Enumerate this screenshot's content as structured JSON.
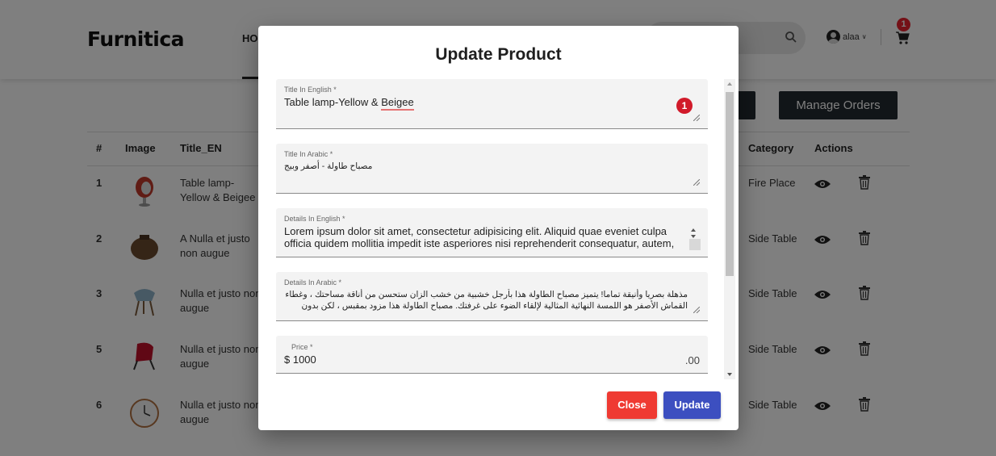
{
  "header": {
    "logo": "Furnitica",
    "nav_home": "HO",
    "user_name": "alaa",
    "cart_count": "1"
  },
  "actions": {
    "manage_orders": "Manage Orders"
  },
  "table": {
    "headers": {
      "num": "#",
      "image": "Image",
      "title": "Title_EN",
      "category": "Category",
      "actions": "Actions"
    },
    "rows": [
      {
        "num": "1",
        "title": "Table lamp-Yellow & Beigee",
        "category": "Fire Place",
        "image_icon": "egg-chair-icon"
      },
      {
        "num": "2",
        "title": "A Nulla et justo non augue",
        "category": "Side Table",
        "image_icon": "wicker-basket-icon"
      },
      {
        "num": "3",
        "title": "Nulla et justo non augue",
        "category": "Side Table",
        "image_icon": "blue-chair-icon"
      },
      {
        "num": "5",
        "title": "Nulla et justo non augue",
        "category": "Side Table",
        "image_icon": "red-chair-icon"
      },
      {
        "num": "6",
        "title": "Nulla et justo non augue",
        "category": "Side Table",
        "image_icon": "wall-clock-icon"
      }
    ]
  },
  "modal": {
    "title": "Update Product",
    "fields": {
      "title_en": {
        "label": "Title In English *",
        "value_before": "Table lamp-Yellow & ",
        "value_misspelled": "Beigee",
        "badge": "1"
      },
      "title_ar": {
        "label": "Title In Arabic *",
        "value": "مصباح طاولة - أصفر وبيج"
      },
      "details_en": {
        "label": "Details In English *",
        "value": "Lorem ipsum dolor sit amet, consectetur adipisicing elit. Aliquid quae eveniet culpa officia quidem mollitia impedit iste asperiores nisi reprehenderit consequatur, autem,"
      },
      "details_ar": {
        "label": "Details In Arabic *",
        "value": "مذهلة بصريا وأنيقة تماما! يتميز مصباح الطاولة هذا بأرجل خشبية من خشب الزان ستحسن من أناقة مساحتك ، وغطاء القماش الأصفر هو اللمسة النهائية المثالية لإلقاء الضوء على غرفتك. مصباح الطاولة هذا مزود بمقبس ، لكن بدون مصابيح."
      },
      "price": {
        "label": "Price *",
        "value": "$ 1000",
        "suffix": ".00"
      }
    },
    "close_label": "Close",
    "update_label": "Update"
  },
  "colors": {
    "close_button": "#ef3a32",
    "update_button": "#3c4fc0",
    "badge": "#d11a2a",
    "dark_button": "#222a30"
  }
}
